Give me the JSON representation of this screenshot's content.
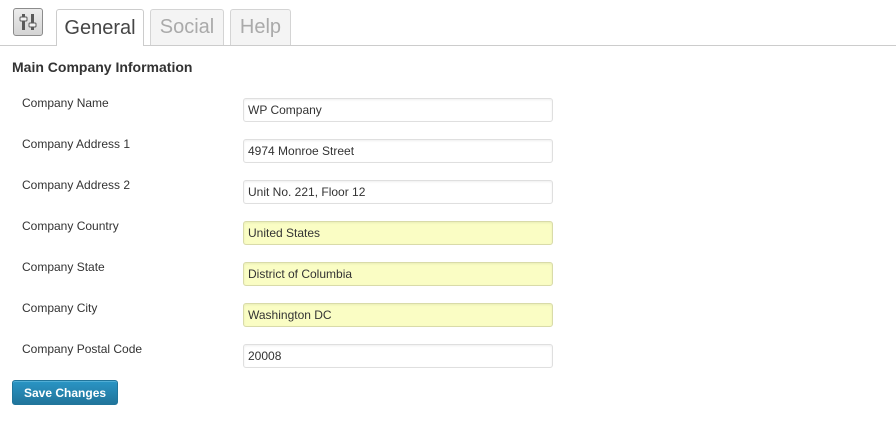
{
  "tabs": [
    {
      "label": "General",
      "active": true
    },
    {
      "label": "Social",
      "active": false
    },
    {
      "label": "Help",
      "active": false
    }
  ],
  "settings_icon": "sliders-icon",
  "section": {
    "title": "Main Company Information"
  },
  "fields": [
    {
      "label": "Company Name",
      "value": "WP Company"
    },
    {
      "label": "Company Address 1",
      "value": "4974 Monroe Street"
    },
    {
      "label": "Company Address 2",
      "value": "Unit No. 221, Floor 12"
    },
    {
      "label": "Company Country",
      "value": "United States"
    },
    {
      "label": "Company State",
      "value": "District of Columbia"
    },
    {
      "label": "Company City",
      "value": "Washington DC"
    },
    {
      "label": "Company Postal Code",
      "value": "20008"
    }
  ],
  "save_button": {
    "label": "Save Changes"
  },
  "colors": {
    "primary_button": "#21759b",
    "autofill_background": "#fafdc4"
  }
}
